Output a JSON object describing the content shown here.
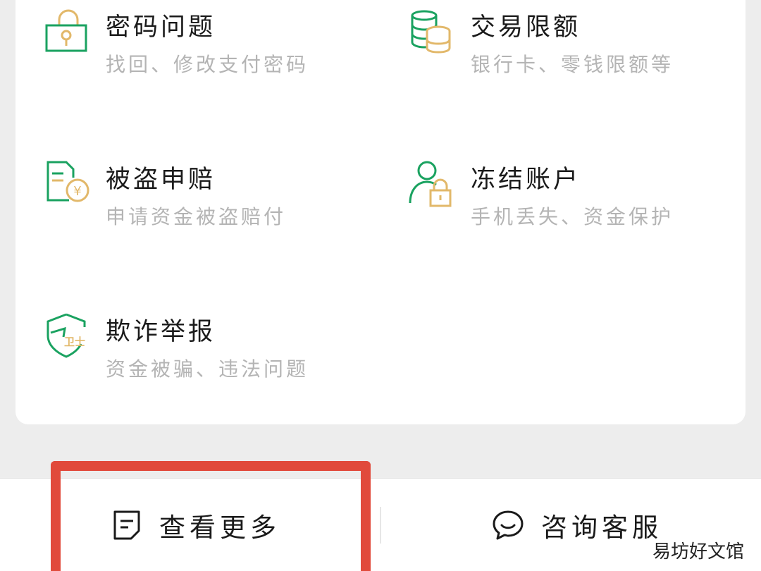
{
  "colors": {
    "green": "#1aa260",
    "gold": "#e2b86a",
    "highlight_border": "#e14a3b",
    "title_text": "#1a1a1a",
    "desc_text": "#b4b4b4"
  },
  "services": [
    {
      "title": "密码问题",
      "desc": "找回、修改支付密码",
      "icon": "padlock-icon"
    },
    {
      "title": "交易限额",
      "desc": "银行卡、零钱限额等",
      "icon": "coin-stack-icon"
    },
    {
      "title": "被盗申赔",
      "desc": "申请资金被盗赔付",
      "icon": "document-yuan-icon"
    },
    {
      "title": "冻结账户",
      "desc": "手机丢失、资金保护",
      "icon": "user-lock-icon"
    },
    {
      "title": "欺诈举报",
      "desc": "资金被骗、违法问题",
      "icon": "shield-guard-icon"
    }
  ],
  "bottom_bar": {
    "more": {
      "label": "查看更多",
      "icon": "document-icon"
    },
    "support": {
      "label": "咨询客服",
      "icon": "chat-bubble-icon"
    }
  },
  "watermark": "易坊好文馆"
}
